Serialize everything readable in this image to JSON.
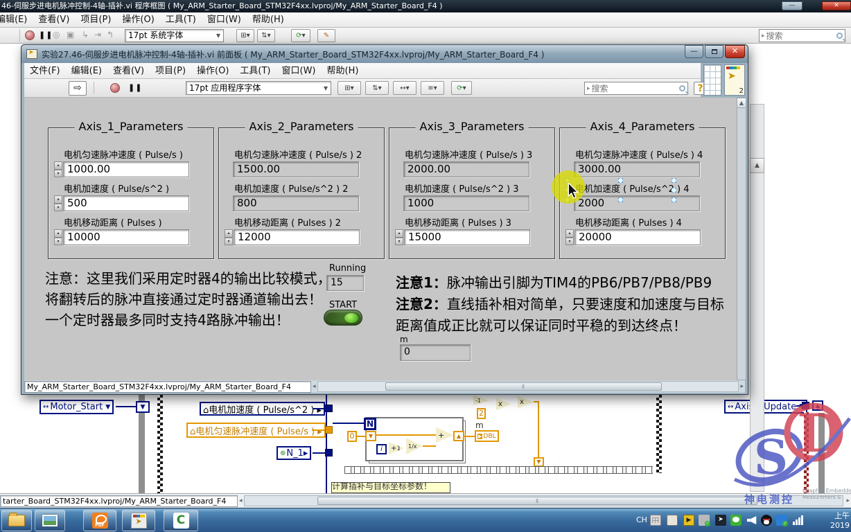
{
  "bg_window": {
    "title": "46-伺服步进电机脉冲控制-4轴-插补.vi 程序框图 ( My_ARM_Starter_Board_STM32F4xx.lvproj/My_ARM_Starter_Board_F4 )",
    "menu": [
      "编辑(E)",
      "查看(V)",
      "项目(P)",
      "操作(O)",
      "工具(T)",
      "窗口(W)",
      "帮助(H)"
    ],
    "font_selector": "17pt 系统字体",
    "search_placeholder": "搜索",
    "status_text": "tarter_Board_STM32F4xx.lvproj/My_ARM_Starter_Board_F4"
  },
  "front_panel": {
    "title": "实验27.46-伺服步进电机脉冲控制-4轴-插补.vi 前面板 ( My_ARM_Starter_Board_STM32F4xx.lvproj/My_ARM_Starter_Board_F4 )",
    "menu": [
      "文件(F)",
      "编辑(E)",
      "查看(V)",
      "项目(P)",
      "操作(O)",
      "工具(T)",
      "窗口(W)",
      "帮助(H)"
    ],
    "font_selector": "17pt 应用程序字体",
    "search_placeholder": "搜索",
    "help_label": "?",
    "icon_badge": "2",
    "status_text": "My_ARM_Starter_Board_STM32F4xx.lvproj/My_ARM_Starter_Board_F4",
    "axis_groups": [
      {
        "title": "Axis_1_Parameters",
        "fields": [
          {
            "label": "电机匀速脉冲速度 ( Pulse/s )",
            "value": "1000.00"
          },
          {
            "label": "电机加速度 ( Pulse/s^2 )",
            "value": "500"
          },
          {
            "label": "电机移动距离 ( Pulses )",
            "value": "10000"
          }
        ]
      },
      {
        "title": "Axis_2_Parameters",
        "fields": [
          {
            "label": "电机匀速脉冲速度 ( Pulse/s )  2",
            "value": "1500.00"
          },
          {
            "label": "电机加速度 ( Pulse/s^2 )  2",
            "value": "800"
          },
          {
            "label": "电机移动距离 ( Pulses )  2",
            "value": "12000"
          }
        ]
      },
      {
        "title": "Axis_3_Parameters",
        "fields": [
          {
            "label": "电机匀速脉冲速度 ( Pulse/s )  3",
            "value": "2000.00"
          },
          {
            "label": "电机加速度 ( Pulse/s^2 )  3",
            "value": "1000"
          },
          {
            "label": "电机移动距离 ( Pulses )  3",
            "value": "15000"
          }
        ]
      },
      {
        "title": "Axis_4_Parameters",
        "fields": [
          {
            "label": "电机匀速脉冲速度 ( Pulse/s )  4",
            "value": "3000.00"
          },
          {
            "label": "电机加速度 ( Pulse/s^2 )  4",
            "value": "2000"
          },
          {
            "label": "电机移动距离 ( Pulses )  4",
            "value": "20000"
          }
        ]
      }
    ],
    "note_left_lines": [
      "注意：这里我们采用定时器4的输出比较模式，",
      "将翻转后的脉冲直接通过定时器通道输出去！",
      "一个定时器最多同时支持4路脉冲输出！"
    ],
    "running_label": "Running",
    "running_value": "15",
    "start_label": "START",
    "note1_prefix": "注意1：",
    "note1_text": "脉冲输出引脚为TIM4的PB6/PB7/PB8/PB9",
    "note2_prefix": "注意2：",
    "note2_text": "直线插补相对简单，只要速度和加速度与目标",
    "note2_text2": "距离值成正比就可以保证同时平稳的到达终点！",
    "m_label": "m",
    "m_value": "0"
  },
  "block_diagram": {
    "motor_start": "Motor_Start",
    "accel_local": "⌂电机加速度 ( Pulse/s^2 ) ▸",
    "speed_local": "⌂电机匀速脉冲速度 ( Pulse/s ) ▸",
    "n1_global": "N_1▸",
    "loop_count": "N",
    "const_zero": "0",
    "iter": "i",
    "inc": "+1",
    "recip": "1/x",
    "add": "+",
    "const_two": "2",
    "m_label": "m",
    "dbl": "DBL",
    "neg1": "-1",
    "mul1": "x",
    "mul2": "x",
    "axis2_update": "Axis2_Update",
    "comment_clipped": "计算插补与目标坐标参数！"
  },
  "watermark": {
    "brand_cn": "神电测控",
    "brand_en": "Graphic Embedded",
    "brand_en2": "Measurement &"
  },
  "taskbar": {
    "lang": "CH",
    "clock_line1": "上午",
    "clock_line2": "2019"
  }
}
